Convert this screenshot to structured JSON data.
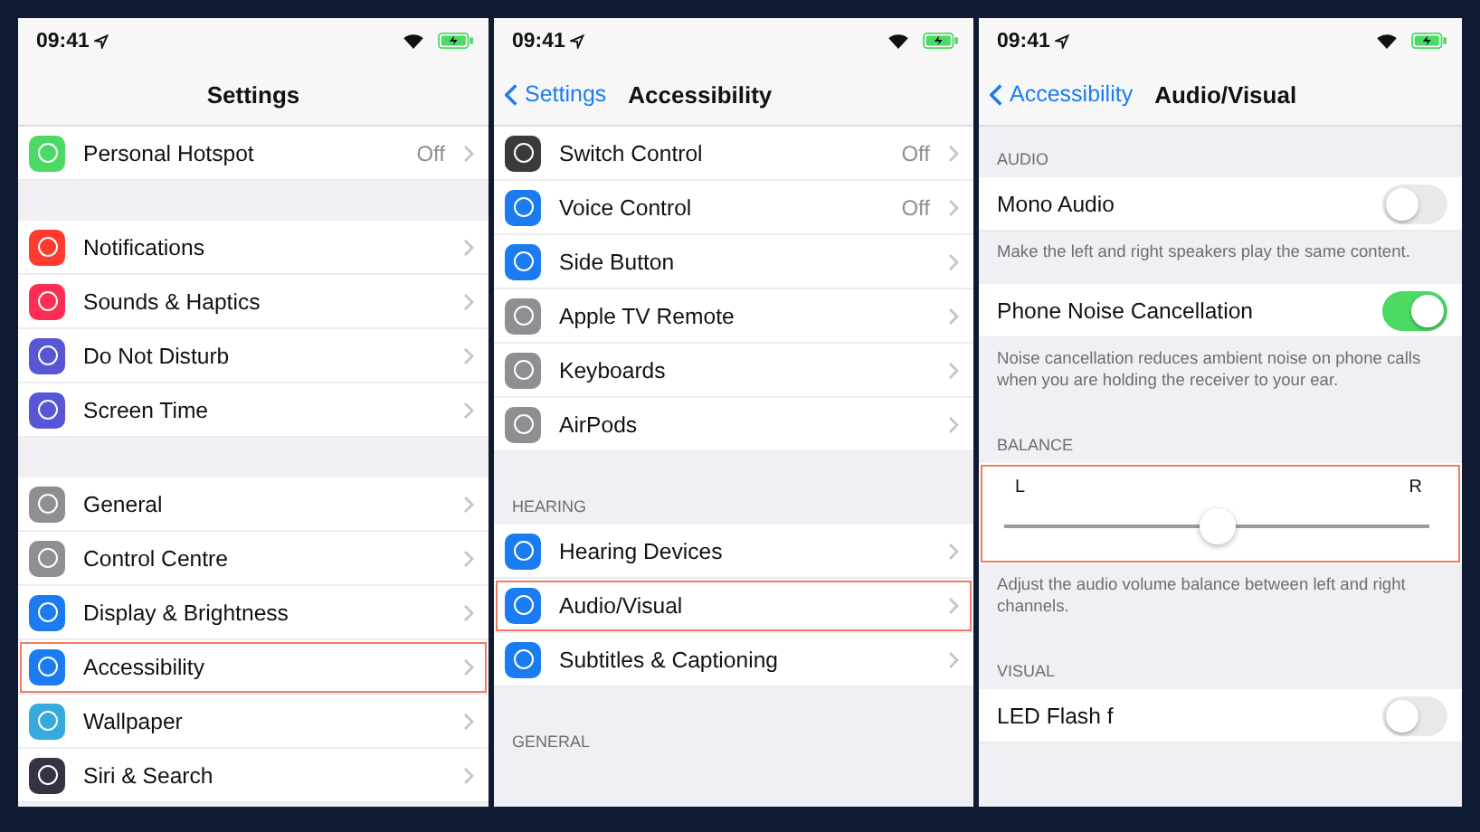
{
  "screens": [
    {
      "time": "09:41",
      "title": "Settings",
      "items": [
        {
          "kind": "row",
          "label": "Personal Hotspot",
          "value": "Off",
          "color": "#4cd964",
          "highlighted": false
        },
        {
          "kind": "gap"
        },
        {
          "kind": "row",
          "label": "Notifications",
          "color": "#ff3b30",
          "highlighted": false
        },
        {
          "kind": "row",
          "label": "Sounds & Haptics",
          "color": "#ff2d55",
          "highlighted": false
        },
        {
          "kind": "row",
          "label": "Do Not Disturb",
          "color": "#5856d6",
          "highlighted": false
        },
        {
          "kind": "row",
          "label": "Screen Time",
          "color": "#5856d6",
          "highlighted": false
        },
        {
          "kind": "gap"
        },
        {
          "kind": "row",
          "label": "General",
          "color": "#8e8e93",
          "highlighted": false
        },
        {
          "kind": "row",
          "label": "Control Centre",
          "color": "#8e8e93",
          "highlighted": false
        },
        {
          "kind": "row",
          "label": "Display & Brightness",
          "color": "#1a7cf0",
          "highlighted": false
        },
        {
          "kind": "row",
          "label": "Accessibility",
          "color": "#1a7cf0",
          "highlighted": true
        },
        {
          "kind": "row",
          "label": "Wallpaper",
          "color": "#35aadc",
          "highlighted": false
        },
        {
          "kind": "row",
          "label": "Siri & Search",
          "color": "#333344",
          "highlighted": false
        }
      ]
    },
    {
      "time": "09:41",
      "back": "Settings",
      "title": "Accessibility",
      "items": [
        {
          "kind": "row",
          "label": "Switch Control",
          "value": "Off",
          "color": "#3a3a3c",
          "highlighted": false
        },
        {
          "kind": "row",
          "label": "Voice Control",
          "value": "Off",
          "color": "#1a7cf0",
          "highlighted": false
        },
        {
          "kind": "row",
          "label": "Side Button",
          "color": "#1a7cf0",
          "highlighted": false
        },
        {
          "kind": "row",
          "label": "Apple TV Remote",
          "color": "#8e8e93",
          "highlighted": false
        },
        {
          "kind": "row",
          "label": "Keyboards",
          "color": "#8e8e93",
          "highlighted": false
        },
        {
          "kind": "row",
          "label": "AirPods",
          "color": "#8e8e93",
          "highlighted": false
        },
        {
          "kind": "header",
          "text": "HEARING"
        },
        {
          "kind": "row",
          "label": "Hearing Devices",
          "color": "#1a7cf0",
          "highlighted": false
        },
        {
          "kind": "row",
          "label": "Audio/Visual",
          "color": "#1a7cf0",
          "highlighted": true
        },
        {
          "kind": "row",
          "label": "Subtitles & Captioning",
          "color": "#1a7cf0",
          "highlighted": false
        },
        {
          "kind": "header",
          "text": "GENERAL"
        }
      ]
    },
    {
      "time": "09:41",
      "back": "Accessibility",
      "title": "Audio/Visual",
      "items": [
        {
          "kind": "header",
          "text": "AUDIO"
        },
        {
          "kind": "toggle",
          "label": "Mono Audio",
          "on": false
        },
        {
          "kind": "footer",
          "text": "Make the left and right speakers play the same content."
        },
        {
          "kind": "toggle",
          "label": "Phone Noise Cancellation",
          "on": true
        },
        {
          "kind": "footer",
          "text": "Noise cancellation reduces ambient noise on phone calls when you are holding the receiver to your ear."
        },
        {
          "kind": "header",
          "text": "BALANCE"
        },
        {
          "kind": "slider",
          "left": "L",
          "right": "R",
          "level": 0.5,
          "highlighted": true
        },
        {
          "kind": "footer",
          "text": "Adjust the audio volume balance between left and right channels."
        },
        {
          "kind": "header",
          "text": "VISUAL"
        },
        {
          "kind": "toggle",
          "label": "LED Flash f",
          "on": false
        }
      ]
    }
  ]
}
